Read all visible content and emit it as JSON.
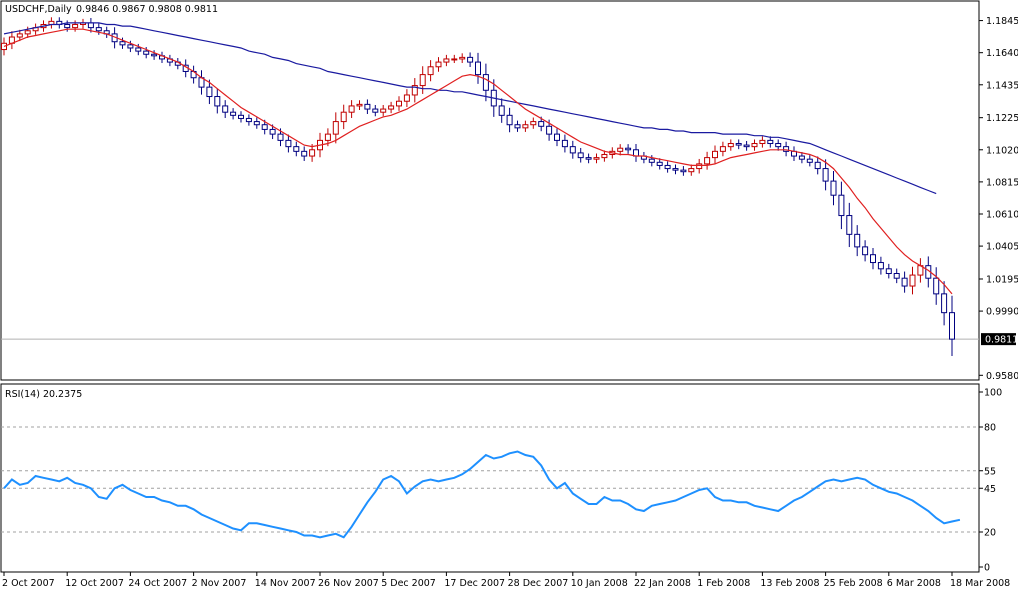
{
  "chart_data": {
    "type": "candlestick",
    "symbol_label": "USDCHF,Daily",
    "ohlc_label": "0.9846 0.9867 0.9808 0.9811",
    "current_price_label": "0.9811",
    "current_price": 0.9811,
    "ylim": [
      0.955,
      1.197
    ],
    "y_ticks": [
      "1.1845",
      "1.1640",
      "1.1435",
      "1.1225",
      "1.1020",
      "1.0815",
      "1.0610",
      "1.0405",
      "1.0195",
      "0.9990",
      "0.9580"
    ],
    "x_ticks": [
      "2 Oct 2007",
      "12 Oct 2007",
      "24 Oct 2007",
      "2 Nov 2007",
      "14 Nov 2007",
      "26 Nov 2007",
      "5 Dec 2007",
      "17 Dec 2007",
      "28 Dec 2007",
      "10 Jan 2008",
      "22 Jan 2008",
      "1 Feb 2008",
      "13 Feb 2008",
      "25 Feb 2008",
      "6 Mar 2008",
      "18 Mar 2008"
    ],
    "x_tick_bars": [
      0,
      8,
      16,
      24,
      32,
      40,
      48,
      56,
      64,
      72,
      80,
      88,
      96,
      104,
      112,
      120
    ],
    "bar_count": 121,
    "close": [
      1.17,
      1.174,
      1.176,
      1.178,
      1.18,
      1.182,
      1.184,
      1.182,
      1.18,
      1.182,
      1.183,
      1.18,
      1.178,
      1.176,
      1.171,
      1.169,
      1.167,
      1.165,
      1.163,
      1.162,
      1.16,
      1.158,
      1.156,
      1.152,
      1.148,
      1.142,
      1.136,
      1.13,
      1.126,
      1.124,
      1.122,
      1.12,
      1.118,
      1.115,
      1.112,
      1.108,
      1.104,
      1.101,
      1.098,
      1.102,
      1.108,
      1.112,
      1.12,
      1.126,
      1.13,
      1.131,
      1.128,
      1.126,
      1.128,
      1.13,
      1.133,
      1.137,
      1.143,
      1.15,
      1.155,
      1.158,
      1.16,
      1.16,
      1.161,
      1.158,
      1.15,
      1.14,
      1.13,
      1.124,
      1.118,
      1.116,
      1.118,
      1.12,
      1.117,
      1.112,
      1.108,
      1.104,
      1.1,
      1.097,
      1.096,
      1.097,
      1.099,
      1.101,
      1.103,
      1.102,
      1.098,
      1.096,
      1.094,
      1.092,
      1.09,
      1.089,
      1.088,
      1.09,
      1.093,
      1.097,
      1.101,
      1.104,
      1.106,
      1.105,
      1.104,
      1.106,
      1.108,
      1.106,
      1.104,
      1.101,
      1.098,
      1.096,
      1.094,
      1.09,
      1.082,
      1.073,
      1.06,
      1.048,
      1.04,
      1.035,
      1.03,
      1.026,
      1.023,
      1.02,
      1.015,
      1.022,
      1.028,
      1.02,
      1.01,
      0.998,
      0.9811
    ],
    "ma_fast": [
      1.168,
      1.17,
      1.172,
      1.174,
      1.175,
      1.176,
      1.177,
      1.178,
      1.179,
      1.179,
      1.179,
      1.178,
      1.177,
      1.176,
      1.174,
      1.172,
      1.17,
      1.168,
      1.166,
      1.164,
      1.162,
      1.16,
      1.158,
      1.155,
      1.152,
      1.148,
      1.145,
      1.141,
      1.137,
      1.133,
      1.129,
      1.126,
      1.123,
      1.12,
      1.117,
      1.114,
      1.111,
      1.108,
      1.105,
      1.104,
      1.105,
      1.106,
      1.108,
      1.111,
      1.114,
      1.117,
      1.119,
      1.121,
      1.123,
      1.124,
      1.126,
      1.128,
      1.131,
      1.134,
      1.137,
      1.14,
      1.143,
      1.146,
      1.149,
      1.15,
      1.149,
      1.147,
      1.144,
      1.14,
      1.136,
      1.132,
      1.128,
      1.125,
      1.122,
      1.119,
      1.116,
      1.113,
      1.11,
      1.107,
      1.105,
      1.103,
      1.101,
      1.1,
      1.099,
      1.099,
      1.098,
      1.098,
      1.097,
      1.096,
      1.095,
      1.094,
      1.093,
      1.092,
      1.092,
      1.092,
      1.093,
      1.095,
      1.097,
      1.098,
      1.099,
      1.1,
      1.101,
      1.102,
      1.102,
      1.102,
      1.101,
      1.1,
      1.099,
      1.097,
      1.094,
      1.09,
      1.084,
      1.078,
      1.071,
      1.065,
      1.058,
      1.052,
      1.046,
      1.04,
      1.035,
      1.031,
      1.028,
      1.025,
      1.021,
      1.016,
      1.01
    ],
    "ma_slow": [
      1.176,
      1.177,
      1.178,
      1.179,
      1.18,
      1.181,
      1.182,
      1.182,
      1.183,
      1.183,
      1.183,
      1.183,
      1.183,
      1.182,
      1.182,
      1.181,
      1.181,
      1.18,
      1.179,
      1.178,
      1.177,
      1.176,
      1.175,
      1.174,
      1.173,
      1.172,
      1.171,
      1.17,
      1.169,
      1.168,
      1.167,
      1.165,
      1.164,
      1.163,
      1.161,
      1.16,
      1.159,
      1.157,
      1.156,
      1.155,
      1.154,
      1.152,
      1.151,
      1.15,
      1.149,
      1.148,
      1.147,
      1.146,
      1.145,
      1.144,
      1.143,
      1.142,
      1.142,
      1.141,
      1.141,
      1.14,
      1.14,
      1.139,
      1.139,
      1.138,
      1.137,
      1.136,
      1.135,
      1.134,
      1.133,
      1.132,
      1.131,
      1.13,
      1.129,
      1.128,
      1.127,
      1.126,
      1.125,
      1.124,
      1.123,
      1.122,
      1.121,
      1.12,
      1.119,
      1.118,
      1.117,
      1.116,
      1.116,
      1.115,
      1.115,
      1.114,
      1.114,
      1.113,
      1.113,
      1.113,
      1.113,
      1.112,
      1.112,
      1.112,
      1.112,
      1.111,
      1.111,
      1.11,
      1.11,
      1.109,
      1.108,
      1.107,
      1.106,
      1.104,
      1.102,
      1.1,
      1.098,
      1.096,
      1.094,
      1.092,
      1.09,
      1.088,
      1.086,
      1.084,
      1.082,
      1.08,
      1.078,
      1.076,
      1.074
    ],
    "rsi_label": "RSI(14) 20.2375",
    "rsi_ylim": [
      0,
      100
    ],
    "rsi_ticks": [
      "100",
      "80",
      "55",
      "45",
      "20",
      "0"
    ],
    "rsi_levels": [
      80,
      55,
      45,
      20
    ],
    "rsi": [
      45,
      50,
      47,
      48,
      52,
      51,
      50,
      49,
      51,
      48,
      47,
      45,
      40,
      39,
      45,
      47,
      44,
      42,
      40,
      40,
      38,
      37,
      35,
      35,
      33,
      30,
      28,
      26,
      24,
      22,
      21,
      25,
      25,
      24,
      23,
      22,
      21,
      20,
      18,
      18,
      17,
      18,
      19,
      17,
      23,
      30,
      37,
      43,
      50,
      52,
      49,
      42,
      46,
      49,
      50,
      49,
      50,
      51,
      53,
      56,
      60,
      64,
      62,
      63,
      65,
      66,
      64,
      63,
      58,
      50,
      45,
      48,
      42,
      39,
      36,
      36,
      40,
      38,
      38,
      36,
      33,
      32,
      35,
      36,
      37,
      38,
      40,
      42,
      44,
      45,
      40,
      38,
      38,
      37,
      37,
      35,
      34,
      33,
      32,
      35,
      38,
      40,
      43,
      46,
      49,
      50,
      49,
      50,
      51,
      50,
      47,
      45,
      43,
      42,
      40,
      38,
      35,
      32,
      28,
      25,
      26,
      27
    ],
    "colors": {
      "up_candle": "#c00000",
      "down_candle": "#000080",
      "ma_fast": "#e02020",
      "ma_slow": "#1a1aa0",
      "rsi": "#1e90ff",
      "grid": "#a0a0a0"
    }
  }
}
